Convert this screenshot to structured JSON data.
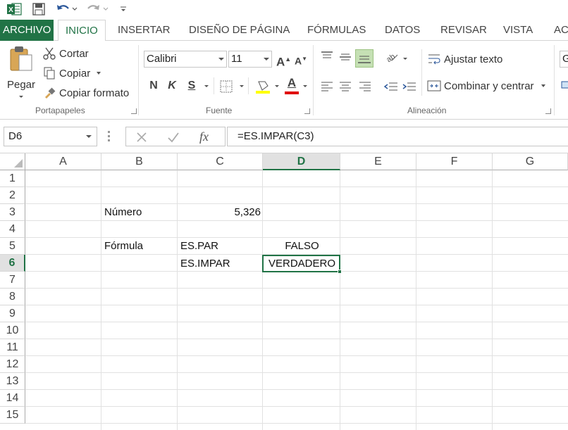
{
  "qat": {
    "icons": [
      "excel-logo-icon",
      "save-icon",
      "undo-icon",
      "redo-icon",
      "customize-qat-icon"
    ],
    "excel_letter": "X"
  },
  "tabs": {
    "file": "ARCHIVO",
    "home": "INICIO",
    "insert": "INSERTAR",
    "page_layout": "DISEÑO DE PÁGINA",
    "formulas": "FÓRMULAS",
    "data": "DATOS",
    "review": "REVISAR",
    "view": "VISTA",
    "more": "AC"
  },
  "clipboard": {
    "paste": "Pegar",
    "cut": "Cortar",
    "copy": "Copiar",
    "format_painter": "Copiar formato",
    "group_label": "Portapapeles"
  },
  "font": {
    "font_name": "Calibri",
    "font_size": "11",
    "bold": "N",
    "italic": "K",
    "underline": "S",
    "grow": "A",
    "shrink": "A",
    "font_color_letter": "A",
    "group_label": "Fuente",
    "highlight_color": "#ffff00",
    "font_color": "#e00000"
  },
  "alignment": {
    "wrap_text": "Ajustar texto",
    "merge_center": "Combinar y centrar",
    "group_label": "Alineación"
  },
  "number": {
    "format_partial": "G"
  },
  "formula_bar": {
    "name_box": "D6",
    "formula": "=ES.IMPAR(C3)",
    "fx": "fx"
  },
  "grid": {
    "columns": [
      "A",
      "B",
      "C",
      "D",
      "E",
      "F",
      "G"
    ],
    "rows": [
      "1",
      "2",
      "3",
      "4",
      "5",
      "6",
      "7",
      "8",
      "9",
      "10",
      "11",
      "12",
      "13",
      "14",
      "15"
    ],
    "selected_column": "D",
    "selected_row": "6",
    "cells": {
      "B3": "Número",
      "C3": "5,326",
      "B5": "Fórmula",
      "C5": "ES.PAR",
      "D5": "FALSO",
      "C6": "ES.IMPAR",
      "D6": "VERDADERO"
    }
  },
  "colors": {
    "accent": "#217346"
  }
}
